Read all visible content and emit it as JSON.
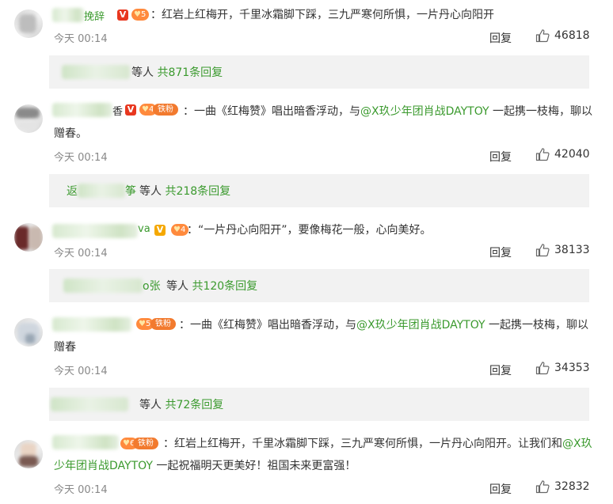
{
  "comments": [
    {
      "name_tail": "挽辞",
      "badge": "V",
      "badge_color": "#e8371f",
      "text_prefix": "：",
      "text": "红岩上红梅开，千里冰霜脚下踩，三九严寒何所惧，一片丹心向阳开",
      "time": "今天 00:14",
      "reply_label": "回复",
      "likes": "46818",
      "thread": {
        "name_tail": "",
        "suffix": "等人",
        "count_label": "共871条回复"
      }
    },
    {
      "name_tail": "香",
      "badge": "V",
      "badge_color": "#e8371f",
      "fan_label": "铁粉",
      "text_prefix": "：",
      "text_before": "一曲《红梅赞》唱出暗香浮动，与",
      "mention": "@X玖少年团肖战DAYTOY",
      "text_after": " 一起携一枝梅，聊以赠春。",
      "time": "今天 00:14",
      "reply_label": "回复",
      "likes": "42040",
      "thread": {
        "name_head": "返",
        "name_tail": "筝",
        "suffix": "等人",
        "count_label": "共218条回复"
      }
    },
    {
      "name_tail": "va",
      "badge": "V",
      "badge_color": "#f5a800",
      "text_prefix": "：",
      "text": "“一片丹心向阳开”，要像梅花一般，心向美好。",
      "time": "今天 00:14",
      "reply_label": "回复",
      "likes": "38133",
      "thread": {
        "name_tail": "o张",
        "suffix": "等人",
        "count_label": "共120条回复"
      }
    },
    {
      "name_tail": "",
      "fan_label": "铁粉",
      "text_prefix": "：",
      "text_before": "一曲《红梅赞》唱出暗香浮动，与",
      "mention": "@X玖少年团肖战DAYTOY",
      "text_after": " 一起携一枝梅，聊以赠春",
      "time": "今天 00:14",
      "reply_label": "回复",
      "likes": "34353",
      "thread": {
        "name_tail": "",
        "suffix": "等人",
        "count_label": "共72条回复"
      }
    },
    {
      "name_tail": "",
      "fan_label": "铁粉",
      "text_prefix": "：",
      "text_before": "红岩上红梅开，千里冰霜脚下踩，三九严寒何所惧，一片丹心向阳开。让我们和",
      "mention": "@X玖少年团肖战DAYTOY",
      "text_after": " 一起祝福明天更美好！祖国未来更富强！",
      "time": "今天 00:14",
      "reply_label": "回复",
      "likes": "32832"
    }
  ]
}
